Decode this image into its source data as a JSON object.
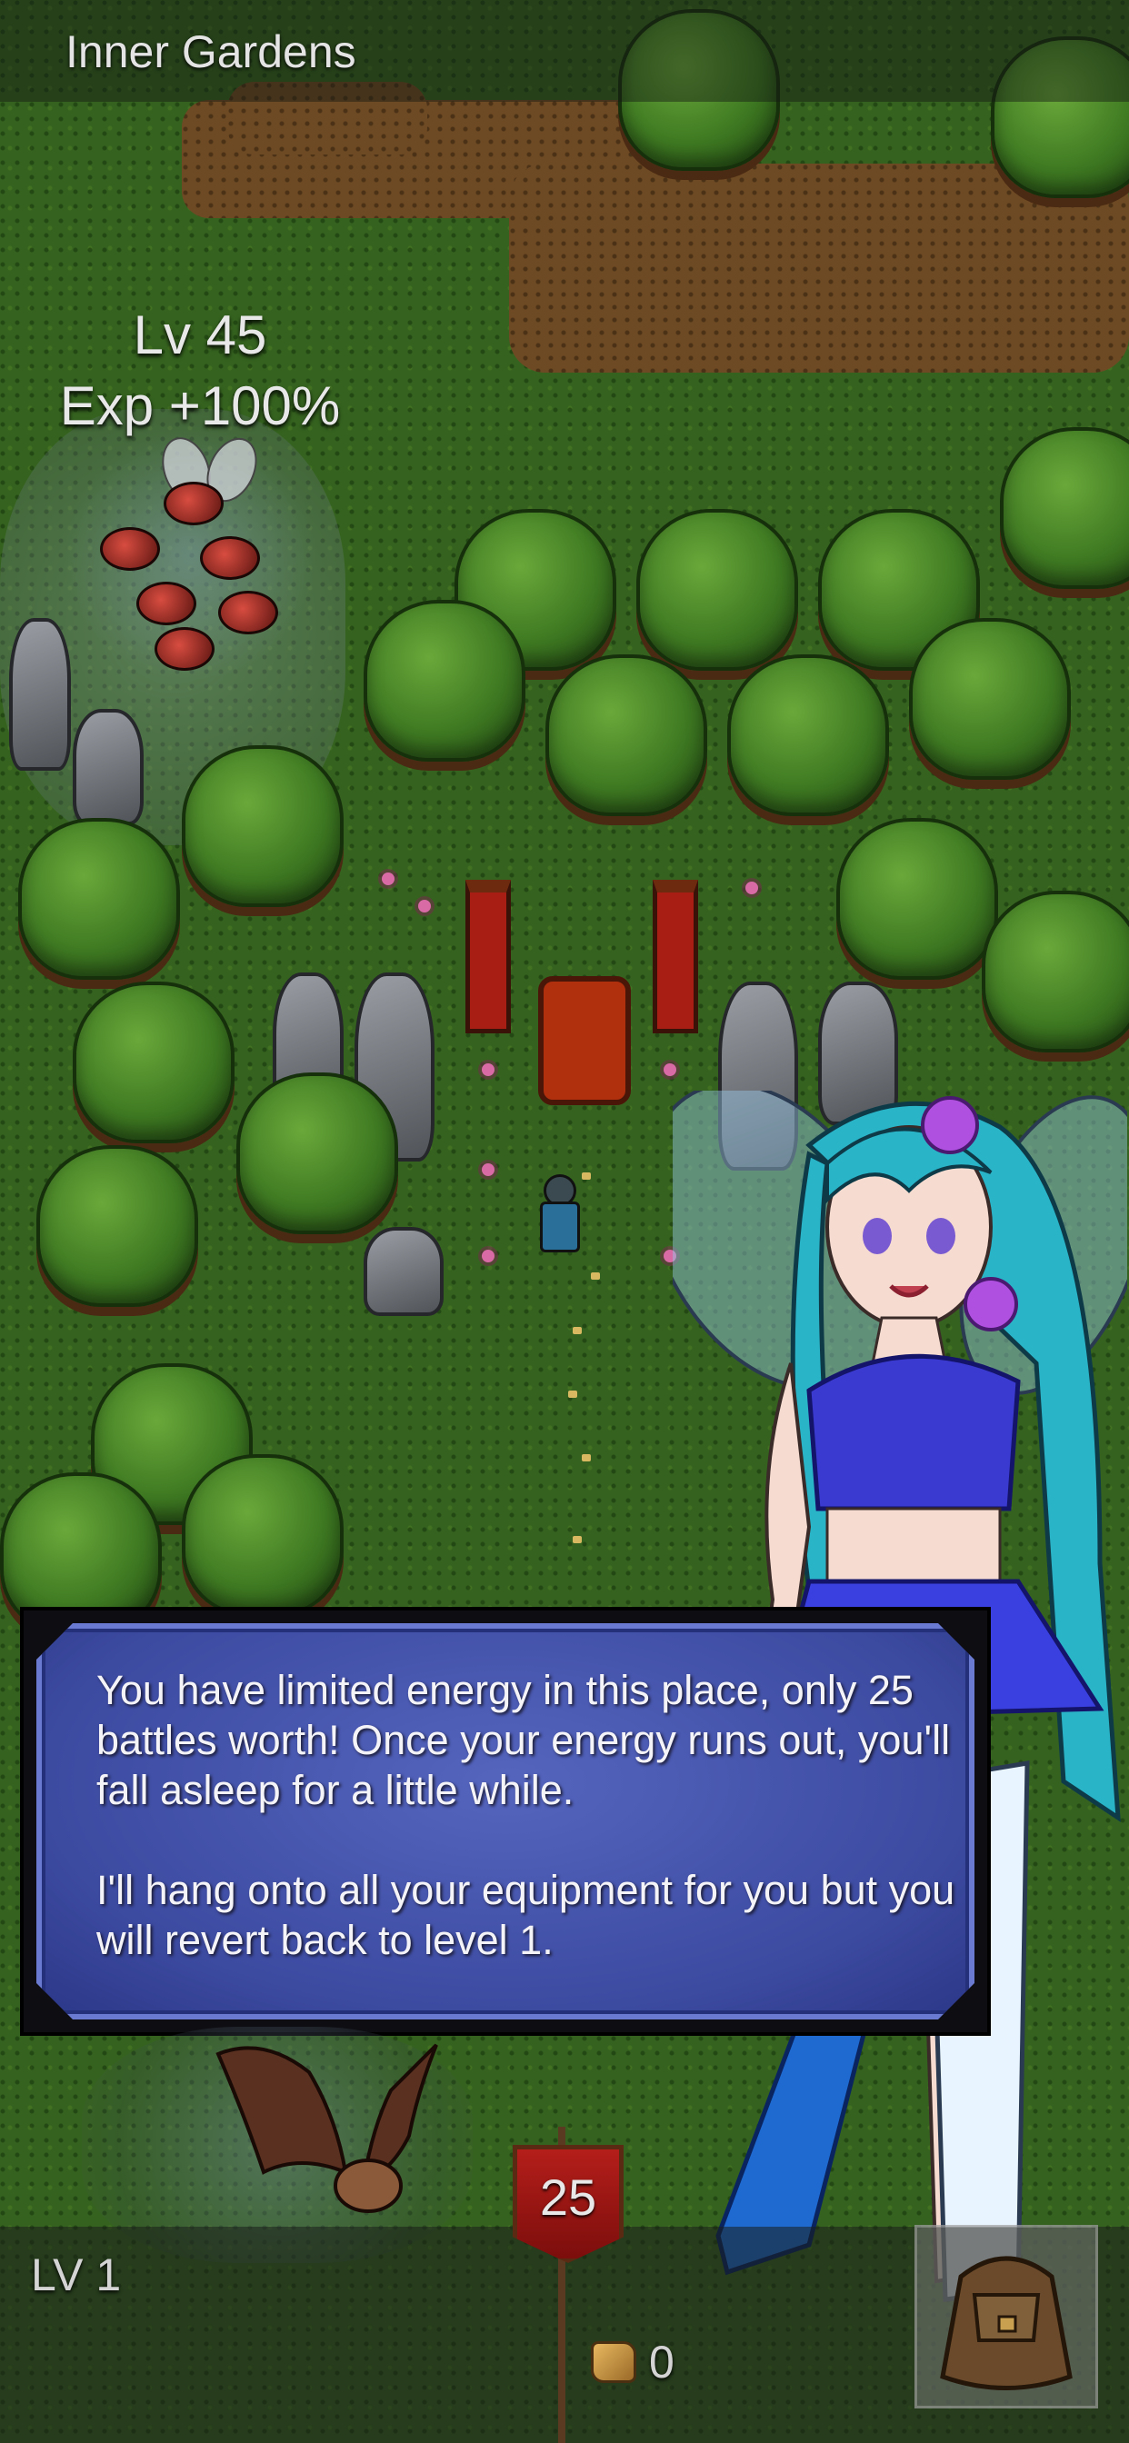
{
  "header": {
    "area_name": "Inner Gardens"
  },
  "enemy": {
    "level": "Lv 45",
    "exp_bonus": "Exp +100%"
  },
  "dialog": {
    "paragraphs": [
      "You have limited energy in this place, only 25 battles worth! Once your energy runs out, you'll fall asleep for a little while.",
      "I'll hang onto all your equipment for you but you will revert back to level 1."
    ]
  },
  "status": {
    "player_level": "LV 1",
    "energy": "25",
    "gold": "0"
  },
  "icons": {
    "gold": "gold-pouch-icon",
    "inventory": "backpack-icon",
    "energy": "banner-flag-icon"
  },
  "colors": {
    "dialog_bg": "#4452aa",
    "dialog_border": "#6a7ad0",
    "energy_flag": "#b41e1a"
  }
}
